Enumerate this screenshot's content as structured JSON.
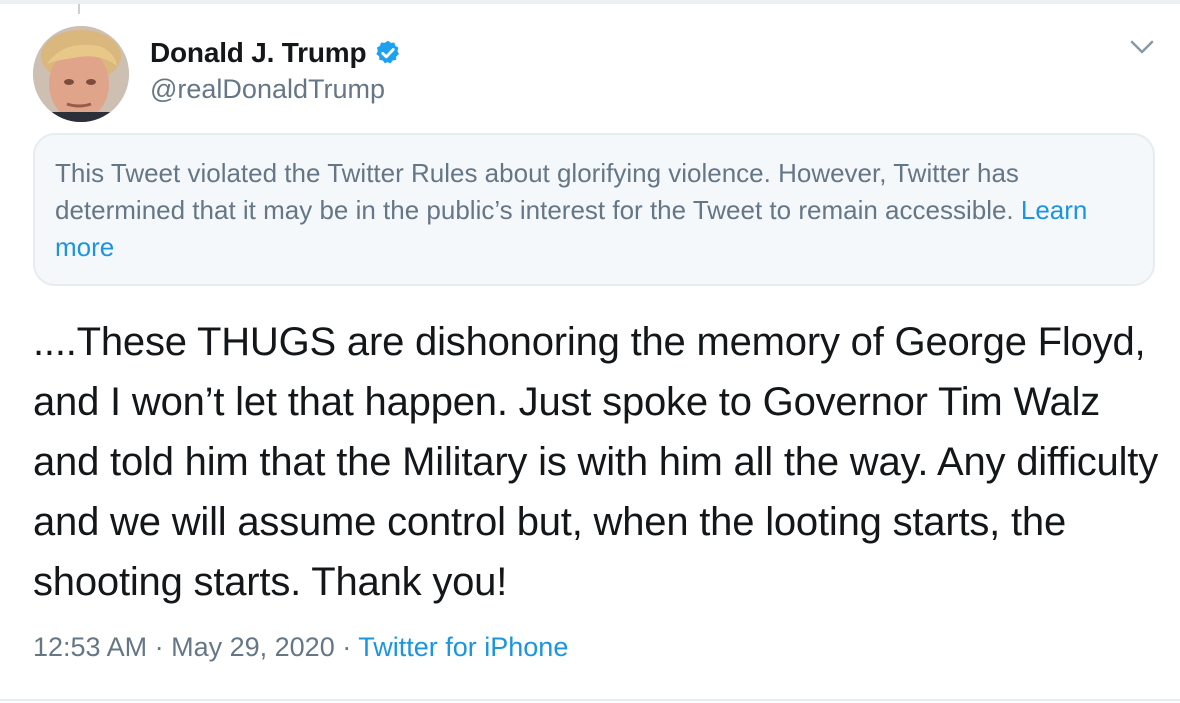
{
  "author": {
    "display_name": "Donald J. Trump",
    "handle": "@realDonaldTrump",
    "verified": true,
    "avatar_icon": "profile-photo"
  },
  "notice": {
    "text": "This Tweet violated the Twitter Rules about glorifying violence. However, Twitter has determined that it may be in the public’s interest for the Tweet to remain accessible.",
    "link": "Learn more"
  },
  "tweet": {
    "text": "....These THUGS are dishonoring the memory of George Floyd, and I won’t let that happen. Just spoke to Governor Tim Walz and told him that the Military is with him all the way. Any difficulty and we will assume control but, when the looting starts, the shooting starts. Thank you!"
  },
  "meta": {
    "time": "12:53 AM",
    "separator": "·",
    "date": "May 29, 2020",
    "source": "Twitter for iPhone"
  },
  "colors": {
    "text_primary": "#14171a",
    "text_secondary": "#657786",
    "link": "#1b95e0",
    "notice_bg": "#f5f8fa",
    "border": "#e6ecf0",
    "verified_badge": "#1da1f2"
  },
  "icons": {
    "verified": "verified-badge-icon",
    "menu": "chevron-down-icon"
  }
}
